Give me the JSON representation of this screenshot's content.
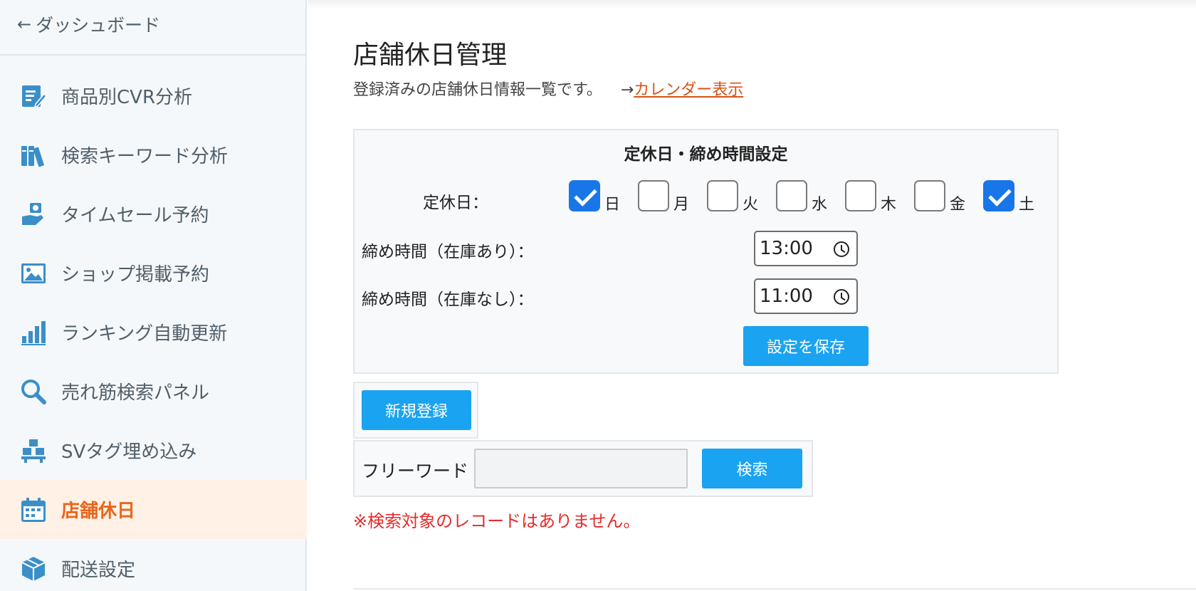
{
  "sidebar": {
    "back_label": "ダッシュボード",
    "items": [
      {
        "label": "商品別CVR分析",
        "icon": "edit-document-icon",
        "active": false
      },
      {
        "label": "検索キーワード分析",
        "icon": "books-icon",
        "active": false
      },
      {
        "label": "タイムセール予約",
        "icon": "money-hand-icon",
        "active": false
      },
      {
        "label": "ショップ掲載予約",
        "icon": "image-icon",
        "active": false
      },
      {
        "label": "ランキング自動更新",
        "icon": "bar-chart-icon",
        "active": false
      },
      {
        "label": "売れ筋検索パネル",
        "icon": "magnifier-icon",
        "active": false
      },
      {
        "label": "SVタグ埋め込み",
        "icon": "boxes-icon",
        "active": false
      },
      {
        "label": "店舗休日",
        "icon": "calendar-icon",
        "active": true
      },
      {
        "label": "配送設定",
        "icon": "package-icon",
        "active": false
      }
    ]
  },
  "main": {
    "title": "店舗休日管理",
    "description": "登録済みの店舗休日情報一覧です。",
    "calendar_arrow": "→",
    "calendar_link": "カレンダー表示"
  },
  "settings": {
    "title": "定休日・締め時間設定",
    "holiday_label": "定休日：",
    "days": [
      {
        "label": "日",
        "checked": true
      },
      {
        "label": "月",
        "checked": false
      },
      {
        "label": "火",
        "checked": false
      },
      {
        "label": "水",
        "checked": false
      },
      {
        "label": "木",
        "checked": false
      },
      {
        "label": "金",
        "checked": false
      },
      {
        "label": "土",
        "checked": true
      }
    ],
    "cutoff_instock_label": "締め時間（在庫あり）：",
    "cutoff_instock_value": "13:00",
    "cutoff_nostock_label": "締め時間（在庫なし）：",
    "cutoff_nostock_value": "11:00",
    "save_label": "設定を保存"
  },
  "actions": {
    "new_label": "新規登録"
  },
  "search": {
    "label": "フリーワード",
    "value": "",
    "placeholder": "",
    "button_label": "検索"
  },
  "messages": {
    "no_records": "※検索対象のレコードはありません。"
  },
  "colors": {
    "accent": "#1aa3f0",
    "active_menu": "#e8661b",
    "active_menu_bg": "#fff1e6",
    "checkbox_checked": "#1976e8",
    "error_text": "#e52b2b",
    "link": "#d4541a",
    "icon": "#3a8fc8"
  }
}
